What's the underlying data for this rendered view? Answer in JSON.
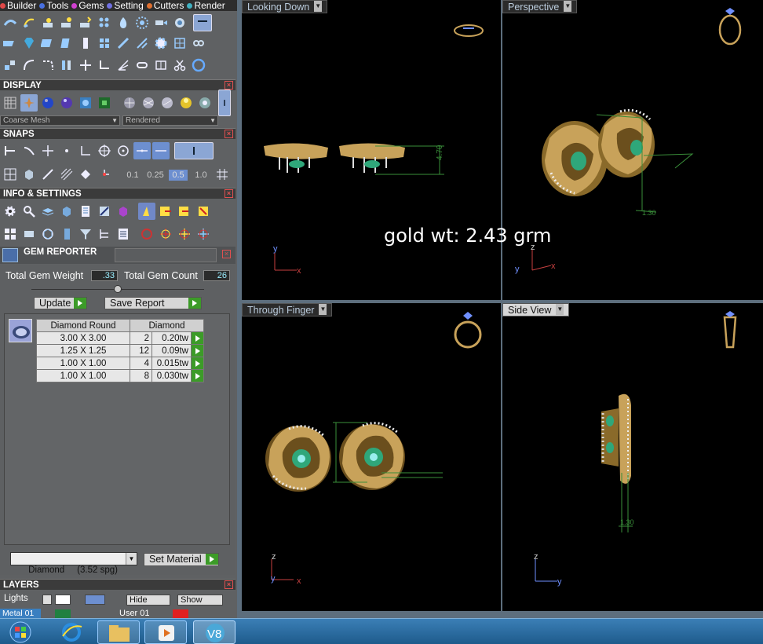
{
  "menu": [
    {
      "label": "Builder",
      "color": "#e04848"
    },
    {
      "label": "Tools",
      "color": "#4870e0"
    },
    {
      "label": "Gems",
      "color": "#d040d0"
    },
    {
      "label": "Setting",
      "color": "#7070e0"
    },
    {
      "label": "Cutters",
      "color": "#e07030"
    },
    {
      "label": "Render",
      "color": "#40b0c0"
    }
  ],
  "display": {
    "title": "DISPLAY",
    "mesh_mode": "Coarse Mesh",
    "render_mode": "Rendered"
  },
  "snaps": {
    "title": "SNAPS",
    "values": [
      "0.1",
      "0.25",
      "0.5",
      "1.0"
    ],
    "selected": "0.5"
  },
  "info": {
    "title": "INFO & SETTINGS"
  },
  "gem_reporter": {
    "title": "GEM REPORTER",
    "total_weight_label": "Total Gem Weight",
    "total_weight": ".33",
    "total_count_label": "Total Gem Count",
    "total_count": "26",
    "update_label": "Update",
    "save_label": "Save Report",
    "table": {
      "headers": [
        "Diamond Round",
        "Diamond"
      ],
      "rows": [
        {
          "size": "3.00 X 3.00",
          "qty": "2",
          "weight": "0.20tw"
        },
        {
          "size": "1.25 X 1.25",
          "qty": "12",
          "weight": "0.09tw"
        },
        {
          "size": "1.00 X 1.00",
          "qty": "4",
          "weight": "0.015tw"
        },
        {
          "size": "1.00 X 1.00",
          "qty": "8",
          "weight": "0.030tw"
        }
      ]
    },
    "material_value": "Diamond     (3.52 spg)",
    "set_material_label": "Set Material"
  },
  "layers": {
    "title": "LAYERS",
    "lights_label": "Lights",
    "hide_label": "Hide",
    "show_label": "Show",
    "metal_label": "Metal 01",
    "user_label": "User 01"
  },
  "viewports": [
    {
      "label": "Looking Down",
      "active": false
    },
    {
      "label": "Perspective",
      "active": false
    },
    {
      "label": "Through Finger",
      "active": false
    },
    {
      "label": "Side View",
      "active": true
    }
  ],
  "dimensions": {
    "looking_down": "4.70",
    "perspective": "1.30",
    "side": "1.30"
  },
  "axes": {
    "looking_down": [
      "y",
      "x"
    ],
    "perspective": [
      "z",
      "y",
      "x"
    ],
    "through_finger": [
      "z",
      "y",
      "x"
    ],
    "side": [
      "z",
      "y"
    ]
  },
  "overlay_text": "gold wt: 2.43 grm",
  "colors": {
    "gold": "#c8a25a",
    "gem_green": "#2fa77a",
    "dimension_green": "#3a8f3a",
    "axis_red": "#c84040",
    "axis_blue": "#7090ff"
  }
}
